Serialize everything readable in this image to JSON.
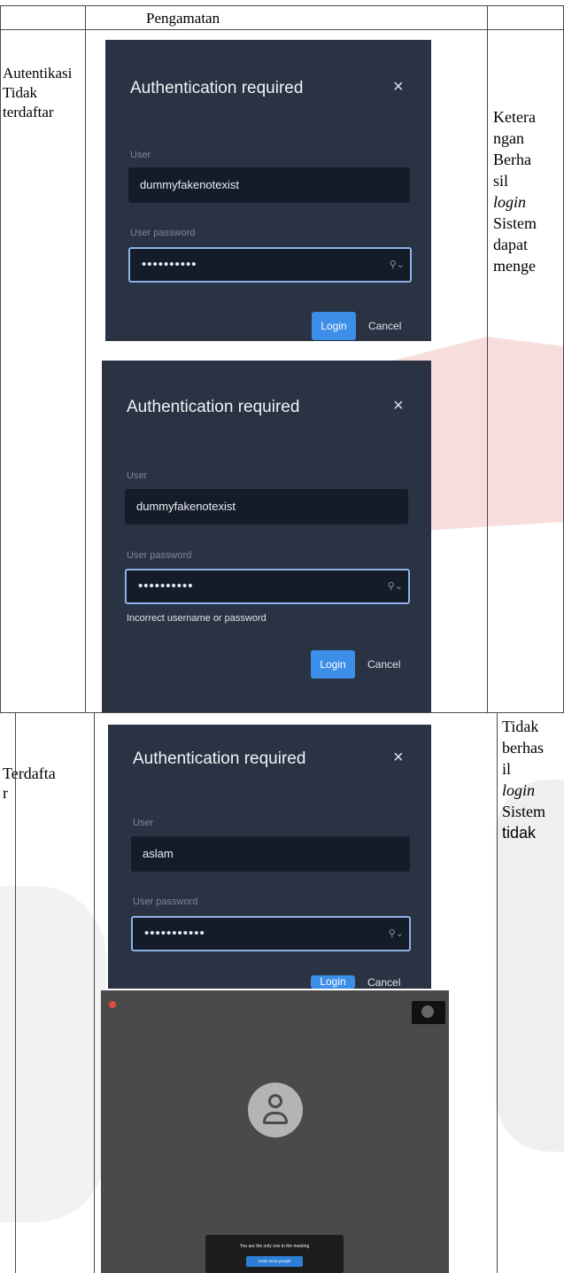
{
  "table": {
    "header": "Pengamatan",
    "row1": {
      "label_lines": [
        "Autentikasi",
        "Tidak",
        "terdaftar"
      ],
      "note_lines": [
        "Ketera",
        "ngan",
        "Berha",
        "sil",
        "login",
        "Sistem",
        "dapat",
        "menge"
      ]
    },
    "row2": {
      "label_lines": [
        "Terdafta",
        "r"
      ],
      "note_lines": [
        "Tidak",
        "berhas",
        "il",
        "login",
        "Sistem",
        "tidak"
      ]
    }
  },
  "dialogs": [
    {
      "title": "Authentication required",
      "close": "×",
      "user_label": "User",
      "user_value": "dummyfakenotexist",
      "password_label": "User password",
      "password_value": "••••••••••",
      "login_label": "Login",
      "cancel_label": "Cancel"
    },
    {
      "title": "Authentication required",
      "close": "×",
      "user_label": "User",
      "user_value": "dummyfakenotexist",
      "password_label": "User password",
      "password_value": "••••••••••",
      "error": "Incorrect username or password",
      "login_label": "Login",
      "cancel_label": "Cancel"
    },
    {
      "title": "Authentication required",
      "close": "×",
      "user_label": "User",
      "user_value": "aslam",
      "password_label": "User password",
      "password_value": "•••••••••••",
      "login_label": "Login",
      "cancel_label": "Cancel"
    }
  ],
  "meeting": {
    "notice": "You are the only one in the meeting",
    "invite_label": "Invite more people"
  },
  "icons": {
    "close": "close-icon",
    "password_toggle": "eye-icon",
    "avatar": "user-avatar-icon",
    "record": "record-icon"
  },
  "colors": {
    "dialog_bg": "#2a3343",
    "input_bg": "#151c29",
    "accent": "#3c8ee8",
    "meeting_bg": "#4a4a4a"
  }
}
